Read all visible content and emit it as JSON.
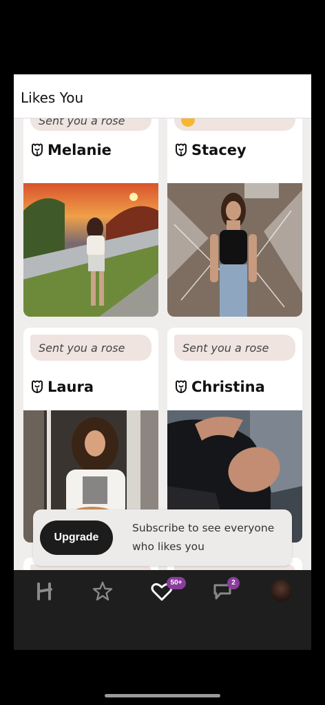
{
  "header": {
    "title": "Likes You"
  },
  "cards": [
    {
      "message": "Sent you a rose",
      "name": "Melanie"
    },
    {
      "message": "",
      "name": "Stacey"
    },
    {
      "message": "Sent you a rose",
      "name": "Laura"
    },
    {
      "message": "Sent you a rose",
      "name": "Christina"
    }
  ],
  "upgrade": {
    "button_label": "Upgrade",
    "text": "Subscribe to see everyone who likes you"
  },
  "nav": {
    "likes_badge": "50+",
    "chats_badge": "2"
  },
  "colors": {
    "accent": "#8a3d9c",
    "bubble": "#efe4e0",
    "nav_bg": "#1e1e1e"
  }
}
